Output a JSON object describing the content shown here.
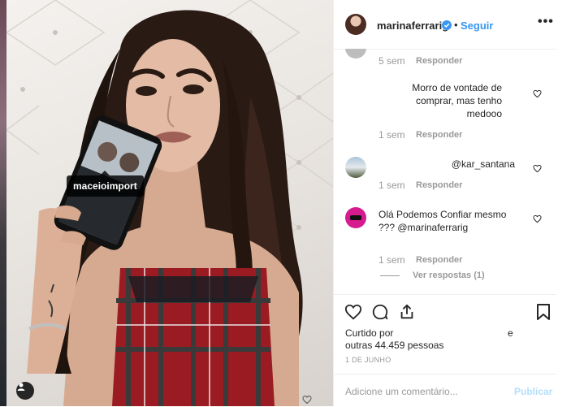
{
  "post": {
    "photo_tag": "maceioimport",
    "icons": {
      "user_tag": "user-tag-icon",
      "photo_heart": "heart-outline-icon"
    }
  },
  "header": {
    "username": "marinaferrarig",
    "separator": "•",
    "follow_label": "Seguir",
    "more_label": "•••",
    "verified_color": "#3897f0"
  },
  "comments": [
    {
      "text": "",
      "time": "5 sem",
      "reply_label": "Responder"
    },
    {
      "text": "Morro de vontade de comprar, mas tenho medooo",
      "time": "1 sem",
      "reply_label": "Responder"
    },
    {
      "text": "@kar_santana",
      "time": "1 sem",
      "reply_label": "Responder"
    },
    {
      "text": "Olá Podemos Confiar mesmo ??? @marinaferrarig",
      "time": "1 sem",
      "reply_label": "Responder",
      "view_replies": "Ver respostas (1)"
    }
  ],
  "actions": {
    "liked_line1": "Curtido por",
    "liked_line2": "outras 44.459 pessoas",
    "liked_line1_trail": "e",
    "date": "1 DE JUNHO"
  },
  "composer": {
    "placeholder": "Adicione um comentário...",
    "publish_label": "Publicar",
    "publish_color": "#b2dffc"
  }
}
